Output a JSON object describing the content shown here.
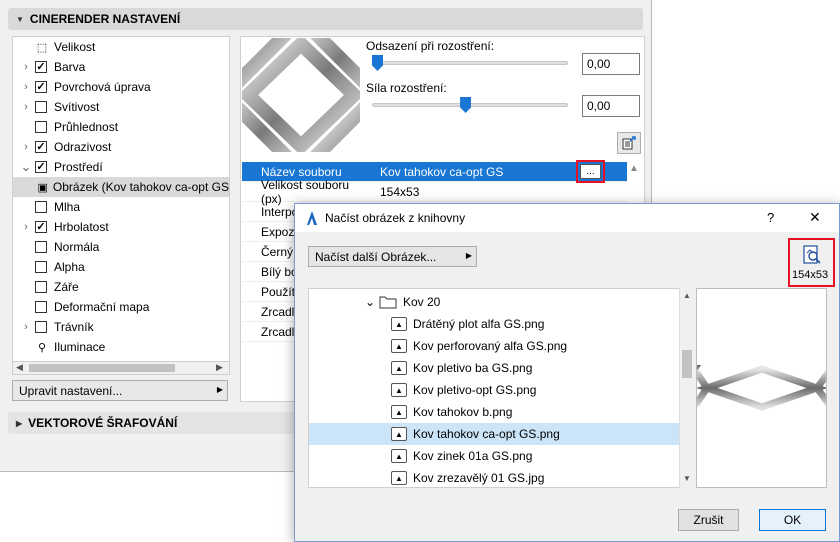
{
  "panel": {
    "section_title": "CINERENDER NASTAVENÍ",
    "tree_items": [
      {
        "label": "Velikost",
        "checkbox": null,
        "expander": false,
        "icon": "resize-icon"
      },
      {
        "label": "Barva",
        "checkbox": true,
        "expander": true
      },
      {
        "label": "Povrchová úprava",
        "checkbox": true,
        "expander": true
      },
      {
        "label": "Svítivost",
        "checkbox": false,
        "expander": true
      },
      {
        "label": "Průhlednost",
        "checkbox": false,
        "expander": false
      },
      {
        "label": "Odrazivost",
        "checkbox": true,
        "expander": true
      },
      {
        "label": "Prostředí",
        "checkbox": true,
        "expander": true,
        "expanded": true
      },
      {
        "label": "Obrázek (Kov tahokov ca-opt GS",
        "checkbox": null,
        "expander": false,
        "icon": "image-icon",
        "selected": true,
        "child": true
      },
      {
        "label": "Mlha",
        "checkbox": false,
        "expander": false
      },
      {
        "label": "Hrbolatost",
        "checkbox": true,
        "expander": true
      },
      {
        "label": "Normála",
        "checkbox": false,
        "expander": false
      },
      {
        "label": "Alpha",
        "checkbox": false,
        "expander": false
      },
      {
        "label": "Záře",
        "checkbox": false,
        "expander": false
      },
      {
        "label": "Deformační mapa",
        "checkbox": false,
        "expander": false
      },
      {
        "label": "Trávník",
        "checkbox": false,
        "expander": true
      },
      {
        "label": "Iluminace",
        "checkbox": null,
        "expander": false,
        "icon": "bulb-icon"
      }
    ],
    "edit_settings_label": "Upravit nastavení...",
    "vector_section_title": "VEKTOROVÉ ŠRAFOVÁNÍ",
    "offset_label": "Odsazení při rozostření:",
    "offset_value": "0,00",
    "offset_level": 0.0,
    "strength_label": "Síla rozostření:",
    "strength_value": "0,00",
    "strength_level": 0.48,
    "props": [
      {
        "key": "Název souboru",
        "value": "Kov tahokov ca-opt GS"
      },
      {
        "key": "Velikost souboru (px)",
        "value": "154x53"
      },
      {
        "key": "Interpo",
        "value": ""
      },
      {
        "key": "Expozi",
        "value": ""
      },
      {
        "key": "Černý",
        "value": ""
      },
      {
        "key": "Bílý bo",
        "value": ""
      },
      {
        "key": "Použít",
        "value": ""
      },
      {
        "key": "Zrcadli",
        "value": ""
      },
      {
        "key": "Zrcadli",
        "value": ""
      }
    ],
    "browse_button_label": "...",
    "accent_color": "#1976d2",
    "highlight_color": "#e81123"
  },
  "dialog": {
    "title": "Načíst obrázek z knihovny",
    "help_label": "?",
    "close_label": "✕",
    "load_more_label": "Načíst další Obrázek...",
    "size_badge": "154x53",
    "folder_name": "Kov 20",
    "files": [
      "Drátěný plot alfa GS.png",
      "Kov perforovaný alfa GS.png",
      "Kov pletivo ba GS.png",
      "Kov pletivo-opt GS.png",
      "Kov tahokov b.png",
      "Kov tahokov ca-opt GS.png",
      "Kov zinek 01a GS.png",
      "Kov zrezavělý 01 GS.jpg"
    ],
    "selected_file_index": 5,
    "cancel_label": "Zrušit",
    "ok_label": "OK"
  }
}
